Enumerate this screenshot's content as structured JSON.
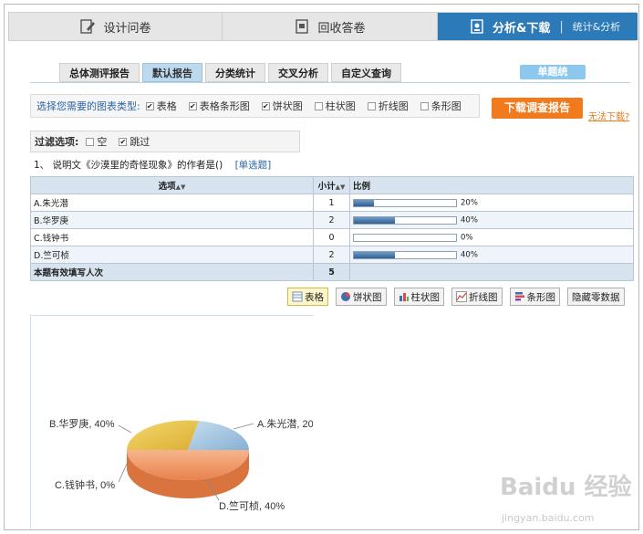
{
  "topnav": {
    "tab1": "设计问卷",
    "tab2": "回收答卷",
    "tab3": "分析&下载",
    "tab3_sub": "统计&分析"
  },
  "subtabs": [
    "总体测评报告",
    "默认报告",
    "分类统计",
    "交叉分析",
    "自定义查询"
  ],
  "single_btn": "单题统",
  "chart_types": {
    "label": "选择您需要的图表类型:",
    "options": [
      {
        "label": "表格",
        "checked": true
      },
      {
        "label": "表格条形图",
        "checked": true
      },
      {
        "label": "饼状图",
        "checked": true
      },
      {
        "label": "柱状图",
        "checked": false
      },
      {
        "label": "折线图",
        "checked": false
      },
      {
        "label": "条形图",
        "checked": false
      }
    ]
  },
  "download": {
    "button": "下载调查报告",
    "link": "无法下载?"
  },
  "filter": {
    "label": "过滤选项:",
    "options": [
      {
        "label": "空",
        "checked": false
      },
      {
        "label": "跳过",
        "checked": true
      }
    ]
  },
  "question": {
    "text": "1、 说明文《沙漠里的奇怪现象》的作者是()",
    "type": "[单选题]"
  },
  "table": {
    "headers": {
      "option": "选项",
      "count": "小计",
      "ratio": "比例"
    },
    "rows": [
      {
        "option": "A.朱光潜",
        "count": "1",
        "pct": "20%",
        "value": 0.2
      },
      {
        "option": "B.华罗庚",
        "count": "2",
        "pct": "40%",
        "value": 0.4
      },
      {
        "option": "C.钱钟书",
        "count": "0",
        "pct": "0%",
        "value": 0
      },
      {
        "option": "D.竺可桢",
        "count": "2",
        "pct": "40%",
        "value": 0.4
      }
    ],
    "total_label": "本题有效填写人次",
    "total_count": "5"
  },
  "toolbar": [
    "表格",
    "饼状图",
    "柱状图",
    "折线图",
    "条形图",
    "隐藏零数据"
  ],
  "pie_labels": {
    "a": "A.朱光潜, 20",
    "b": "B.华罗庚, 40%",
    "c": "C.钱钟书, 0%",
    "d": "D.竺可桢, 40%"
  },
  "colors": {
    "accent": "#2d7ab8",
    "download": "#f07a1c",
    "pie_a": "#9cc2df",
    "pie_b": "#e8c347",
    "pie_d": "#ef9a63"
  },
  "watermark": {
    "brand": "Baidu 经验",
    "url": "jingyan.baidu.com"
  }
}
